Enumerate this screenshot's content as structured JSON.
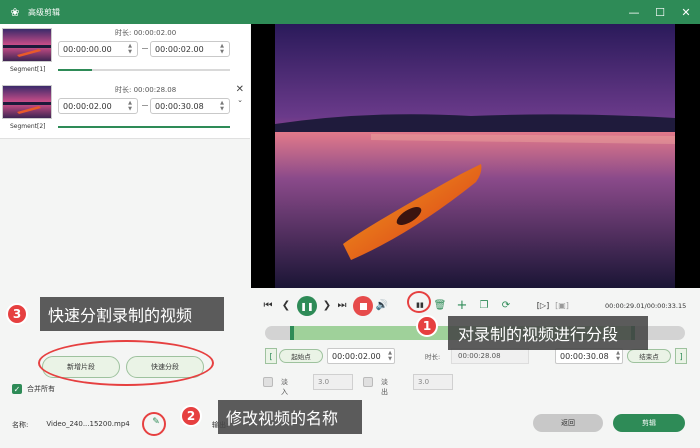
{
  "window": {
    "title": "高级剪辑",
    "logo_icon": "app-logo-icon",
    "minimize_icon": "minimize-icon",
    "maximize_icon": "maximize-icon",
    "close_icon": "close-icon"
  },
  "segments": [
    {
      "label": "Segment[1]",
      "duration_label": "时长: 00:00:02.00",
      "start": "00:00:00.00",
      "end": "00:00:02.00",
      "progress": 0.2
    },
    {
      "label": "Segment[2]",
      "duration_label": "时长: 00:00:28.08",
      "start": "00:00:02.00",
      "end": "00:00:30.08",
      "progress": 1.0
    }
  ],
  "left_buttons": {
    "new_segment": "新增片段",
    "quick_split": "快速分段"
  },
  "merge_all": {
    "label": "合并所有",
    "checked": true
  },
  "file": {
    "name_label": "名称:",
    "name_value": "Video_240...15200.mp4",
    "output_label": "输出:"
  },
  "player": {
    "time_readout": "00:00:29.01/00:00:33.15",
    "icons": [
      "skip-start-icon",
      "step-back-icon",
      "play-pause-icon",
      "step-forward-icon",
      "skip-end-icon",
      "stop-icon",
      "volume-icon",
      "split-icon",
      "delete-icon",
      "add-icon",
      "copy-icon",
      "reset-icon",
      "preview-segment-icon",
      "screenshot-icon"
    ]
  },
  "timeline": {
    "selection_start": 0.06,
    "selection_end": 0.88
  },
  "range": {
    "start_btn": "起始点",
    "start_value": "00:00:02.00",
    "duration_label": "时长:",
    "duration_value": "00:00:28.08",
    "end_value": "00:00:30.08",
    "end_btn": "结束点"
  },
  "fade": {
    "in_label": "淡入",
    "in_value": "3.0",
    "out_label": "淡出",
    "out_value": "3.0"
  },
  "actions": {
    "back": "返回",
    "cut": "剪辑"
  },
  "callouts": [
    {
      "number": "1",
      "text": "对录制的视频进行分段"
    },
    {
      "number": "2",
      "text": "修改视频的名称"
    },
    {
      "number": "3",
      "text": "快速分割录制的视频"
    }
  ],
  "colors": {
    "accent": "#2e8b57",
    "callout_red": "#e64040"
  }
}
